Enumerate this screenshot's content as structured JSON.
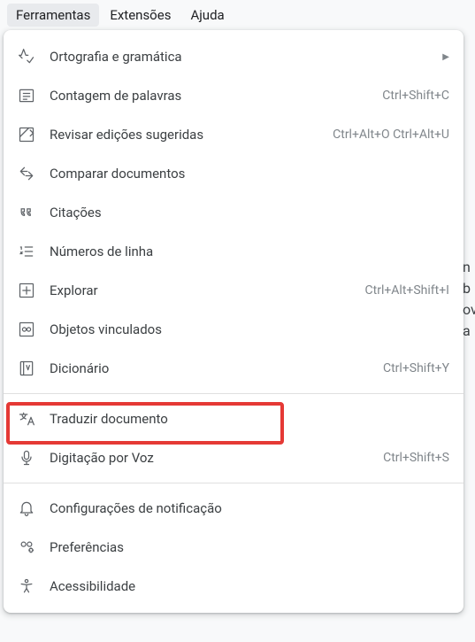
{
  "menubar": {
    "items": [
      {
        "label": "Ferramentas",
        "active": true
      },
      {
        "label": "Extensões",
        "active": false
      },
      {
        "label": "Ajuda",
        "active": false
      }
    ]
  },
  "menu": {
    "items": [
      {
        "label": "Ortografia e gramática",
        "icon": "spellcheck",
        "submenu": true
      },
      {
        "label": "Contagem de palavras",
        "icon": "wordcount",
        "shortcut": "Ctrl+Shift+C"
      },
      {
        "label": "Revisar edições sugeridas",
        "icon": "review",
        "shortcut": "Ctrl+Alt+O Ctrl+Alt+U"
      },
      {
        "label": "Comparar documentos",
        "icon": "compare"
      },
      {
        "label": "Citações",
        "icon": "quote"
      },
      {
        "label": "Números de linha",
        "icon": "linenumbers"
      },
      {
        "label": "Explorar",
        "icon": "explore",
        "shortcut": "Ctrl+Alt+Shift+I"
      },
      {
        "label": "Objetos vinculados",
        "icon": "linked"
      },
      {
        "label": "Dicionário",
        "icon": "dictionary",
        "shortcut": "Ctrl+Shift+Y"
      },
      {
        "divider": true
      },
      {
        "label": "Traduzir documento",
        "icon": "translate",
        "highlighted": true
      },
      {
        "label": "Digitação por Voz",
        "icon": "voice",
        "shortcut": "Ctrl+Shift+S"
      },
      {
        "divider": true
      },
      {
        "label": "Configurações de notificação",
        "icon": "notification"
      },
      {
        "label": "Preferências",
        "icon": "preferences"
      },
      {
        "label": "Acessibilidade",
        "icon": "accessibility"
      }
    ]
  }
}
